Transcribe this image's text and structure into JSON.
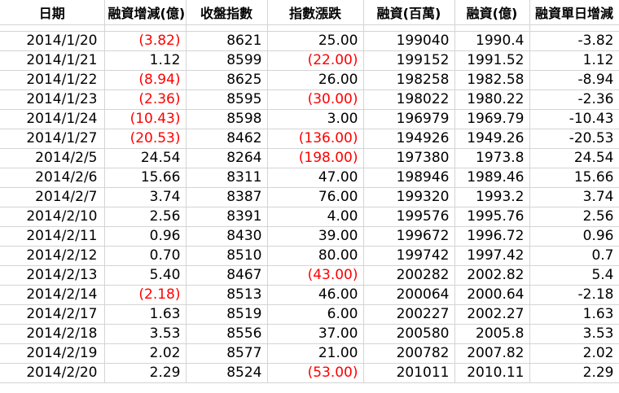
{
  "headers": [
    "日期",
    "融資增減(億)",
    "收盤指數",
    "指數漲跌",
    "融資(百萬)",
    "融資(億)",
    "融資單日增減"
  ],
  "rows": [
    {
      "date": "2014/1/20",
      "change": "(3.82)",
      "change_neg": true,
      "close": "8621",
      "index_change": "25.00",
      "index_neg": false,
      "margin_mil": "199040",
      "margin_yi": "1990.4",
      "daily_change": "-3.82"
    },
    {
      "date": "2014/1/21",
      "change": "1.12",
      "change_neg": false,
      "close": "8599",
      "index_change": "(22.00)",
      "index_neg": true,
      "margin_mil": "199152",
      "margin_yi": "1991.52",
      "daily_change": "1.12"
    },
    {
      "date": "2014/1/22",
      "change": "(8.94)",
      "change_neg": true,
      "close": "8625",
      "index_change": "26.00",
      "index_neg": false,
      "margin_mil": "198258",
      "margin_yi": "1982.58",
      "daily_change": "-8.94"
    },
    {
      "date": "2014/1/23",
      "change": "(2.36)",
      "change_neg": true,
      "close": "8595",
      "index_change": "(30.00)",
      "index_neg": true,
      "margin_mil": "198022",
      "margin_yi": "1980.22",
      "daily_change": "-2.36"
    },
    {
      "date": "2014/1/24",
      "change": "(10.43)",
      "change_neg": true,
      "close": "8598",
      "index_change": "3.00",
      "index_neg": false,
      "margin_mil": "196979",
      "margin_yi": "1969.79",
      "daily_change": "-10.43"
    },
    {
      "date": "2014/1/27",
      "change": "(20.53)",
      "change_neg": true,
      "close": "8462",
      "index_change": "(136.00)",
      "index_neg": true,
      "margin_mil": "194926",
      "margin_yi": "1949.26",
      "daily_change": "-20.53"
    },
    {
      "date": "2014/2/5",
      "change": "24.54",
      "change_neg": false,
      "close": "8264",
      "index_change": "(198.00)",
      "index_neg": true,
      "margin_mil": "197380",
      "margin_yi": "1973.8",
      "daily_change": "24.54"
    },
    {
      "date": "2014/2/6",
      "change": "15.66",
      "change_neg": false,
      "close": "8311",
      "index_change": "47.00",
      "index_neg": false,
      "margin_mil": "198946",
      "margin_yi": "1989.46",
      "daily_change": "15.66"
    },
    {
      "date": "2014/2/7",
      "change": "3.74",
      "change_neg": false,
      "close": "8387",
      "index_change": "76.00",
      "index_neg": false,
      "margin_mil": "199320",
      "margin_yi": "1993.2",
      "daily_change": "3.74"
    },
    {
      "date": "2014/2/10",
      "change": "2.56",
      "change_neg": false,
      "close": "8391",
      "index_change": "4.00",
      "index_neg": false,
      "margin_mil": "199576",
      "margin_yi": "1995.76",
      "daily_change": "2.56"
    },
    {
      "date": "2014/2/11",
      "change": "0.96",
      "change_neg": false,
      "close": "8430",
      "index_change": "39.00",
      "index_neg": false,
      "margin_mil": "199672",
      "margin_yi": "1996.72",
      "daily_change": "0.96"
    },
    {
      "date": "2014/2/12",
      "change": "0.70",
      "change_neg": false,
      "close": "8510",
      "index_change": "80.00",
      "index_neg": false,
      "margin_mil": "199742",
      "margin_yi": "1997.42",
      "daily_change": "0.7"
    },
    {
      "date": "2014/2/13",
      "change": "5.40",
      "change_neg": false,
      "close": "8467",
      "index_change": "(43.00)",
      "index_neg": true,
      "margin_mil": "200282",
      "margin_yi": "2002.82",
      "daily_change": "5.4"
    },
    {
      "date": "2014/2/14",
      "change": "(2.18)",
      "change_neg": true,
      "close": "8513",
      "index_change": "46.00",
      "index_neg": false,
      "margin_mil": "200064",
      "margin_yi": "2000.64",
      "daily_change": "-2.18"
    },
    {
      "date": "2014/2/17",
      "change": "1.63",
      "change_neg": false,
      "close": "8519",
      "index_change": "6.00",
      "index_neg": false,
      "margin_mil": "200227",
      "margin_yi": "2002.27",
      "daily_change": "1.63"
    },
    {
      "date": "2014/2/18",
      "change": "3.53",
      "change_neg": false,
      "close": "8556",
      "index_change": "37.00",
      "index_neg": false,
      "margin_mil": "200580",
      "margin_yi": "2005.8",
      "daily_change": "3.53"
    },
    {
      "date": "2014/2/19",
      "change": "2.02",
      "change_neg": false,
      "close": "8577",
      "index_change": "21.00",
      "index_neg": false,
      "margin_mil": "200782",
      "margin_yi": "2007.82",
      "daily_change": "2.02"
    },
    {
      "date": "2014/2/20",
      "change": "2.29",
      "change_neg": false,
      "close": "8524",
      "index_change": "(53.00)",
      "index_neg": true,
      "margin_mil": "201011",
      "margin_yi": "2010.11",
      "daily_change": "2.29"
    }
  ],
  "colors": {
    "negative": "#ff0000",
    "text": "#000000",
    "gridline": "#d4d4d4"
  }
}
